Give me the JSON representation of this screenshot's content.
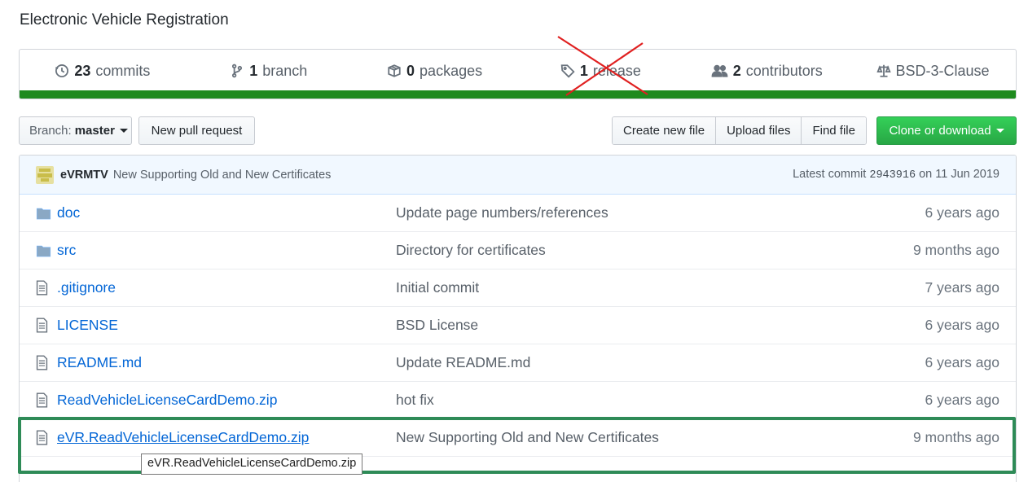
{
  "repo": {
    "description": "Electronic Vehicle Registration"
  },
  "summary": {
    "commits": {
      "count": "23",
      "label": "commits",
      "icon": "history-icon"
    },
    "branches": {
      "count": "1",
      "label": "branch",
      "icon": "branch-icon"
    },
    "packages": {
      "count": "0",
      "label": "packages",
      "icon": "package-icon"
    },
    "releases": {
      "count": "1",
      "label": "release",
      "icon": "tag-icon",
      "crossed_out": true,
      "cross_color": "#e02020"
    },
    "contributors": {
      "count": "2",
      "label": "contributors",
      "icon": "people-icon"
    },
    "license": {
      "label": "BSD-3-Clause",
      "icon": "law-icon"
    },
    "language_bar_color": "#1e8a1e"
  },
  "toolbar": {
    "branch_prefix": "Branch:",
    "branch_name": "master",
    "new_pull_request": "New pull request",
    "create_new_file": "Create new file",
    "upload_files": "Upload files",
    "find_file": "Find file",
    "clone_or_download": "Clone or download",
    "clone_color": "#28a745"
  },
  "latest_commit": {
    "author": "eVRMTV",
    "message": "New Supporting Old and New Certificates",
    "label": "Latest commit",
    "sha": "2943916",
    "date": "on 11 Jun 2019"
  },
  "files": [
    {
      "name": "doc",
      "type": "folder",
      "message": "Update page numbers/references",
      "age": "6 years ago"
    },
    {
      "name": "src",
      "type": "folder",
      "message": "Directory for certificates",
      "age": "9 months ago"
    },
    {
      "name": ".gitignore",
      "type": "file",
      "message": "Initial commit",
      "age": "7 years ago"
    },
    {
      "name": "LICENSE",
      "type": "file",
      "message": "BSD License",
      "age": "6 years ago"
    },
    {
      "name": "README.md",
      "type": "file",
      "message": "Update README.md",
      "age": "6 years ago"
    },
    {
      "name": "ReadVehicleLicenseCardDemo.zip",
      "type": "file",
      "message": "hot fix",
      "age": "6 years ago"
    },
    {
      "name": "eVR.ReadVehicleLicenseCardDemo.zip",
      "type": "file",
      "message": "New Supporting Old and New Certificates",
      "age": "9 months ago"
    }
  ],
  "tooltip": {
    "text": "eVR.ReadVehicleLicenseCardDemo.zip"
  },
  "highlight_color": "#2e8b57"
}
